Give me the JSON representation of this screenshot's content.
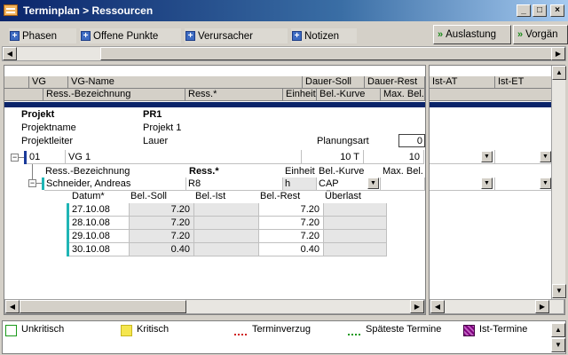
{
  "window": {
    "title": "Terminplan > Ressourcen",
    "minimize": "_",
    "maximize": "□",
    "close": "×"
  },
  "toolbar": {
    "tabs": [
      "Phasen",
      "Offene Punkte",
      "Verursacher",
      "Notizen"
    ],
    "auslastung": "Auslastung",
    "vorgaenge": "Vorgän"
  },
  "grid_header": {
    "row1": [
      "VG",
      "VG-Name",
      "Dauer-Soll",
      "Dauer-Rest"
    ],
    "row2": [
      "Ress.-Bezeichnung",
      "Ress.*",
      "Einheit",
      "Bel.-Kurve",
      "Max. Bel."
    ],
    "right": [
      "Ist-AT",
      "Ist-ET"
    ]
  },
  "project": {
    "projekt_label": "Projekt",
    "projekt_value": "PR1",
    "projektname_label": "Projektname",
    "projektname_value": "Projekt 1",
    "projektleiter_label": "Projektleiter",
    "projektleiter_value": "Lauer",
    "planungsart_label": "Planungsart",
    "planungsart_value": "0"
  },
  "vg_row": {
    "nr": "01",
    "name": "VG 1",
    "dauer_soll": "10 T",
    "dauer_rest": "10"
  },
  "res_header": {
    "bez": "Ress.-Bezeichnung",
    "ress": "Ress.*",
    "einheit": "Einheit",
    "kurve": "Bel.-Kurve",
    "maxbel": "Max. Bel."
  },
  "res_row": {
    "name": "Schneider, Andreas",
    "ress": "R8",
    "einheit": "h",
    "kurve": "CAP"
  },
  "day_table": {
    "headers": [
      "Datum*",
      "Bel.-Soll",
      "Bel.-Ist",
      "Bel.-Rest",
      "Überlast"
    ],
    "rows": [
      {
        "datum": "27.10.08",
        "soll": "7.20",
        "rest": "7.20"
      },
      {
        "datum": "28.10.08",
        "soll": "7.20",
        "rest": "7.20"
      },
      {
        "datum": "29.10.08",
        "soll": "7.20",
        "rest": "7.20"
      },
      {
        "datum": "30.10.08",
        "soll": "0.40",
        "rest": "0.40"
      }
    ]
  },
  "legend": {
    "items": [
      {
        "label": "Unkritisch",
        "color": "#ffffff"
      },
      {
        "label": "Kritisch",
        "color": "#f5e64e"
      },
      {
        "label": "Terminverzug",
        "color": "#d02020"
      },
      {
        "label": "Späteste Termine",
        "color": "#1a9a1a"
      },
      {
        "label": "Ist-Termine",
        "color": "#800080"
      }
    ]
  },
  "colors": {
    "accent": "#0a246a",
    "tree_line": "#1fb5b5",
    "project_bar": "#0a246a"
  }
}
